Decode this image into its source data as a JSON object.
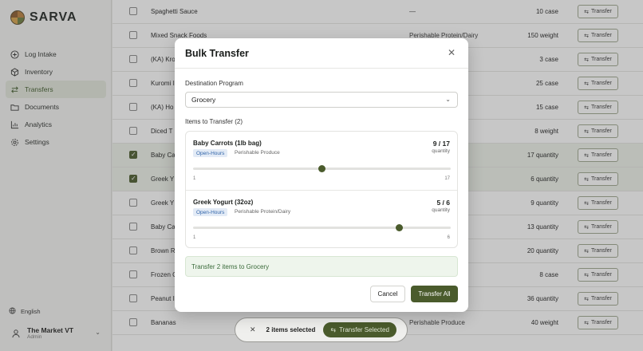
{
  "brand": {
    "name": "SARVA"
  },
  "sidebar": {
    "items": [
      {
        "label": "Log Intake",
        "icon": "plus-circle-icon"
      },
      {
        "label": "Inventory",
        "icon": "box-icon"
      },
      {
        "label": "Transfers",
        "icon": "arrows-icon",
        "active": true
      },
      {
        "label": "Documents",
        "icon": "folder-icon"
      },
      {
        "label": "Analytics",
        "icon": "chart-icon"
      },
      {
        "label": "Settings",
        "icon": "gear-icon"
      }
    ],
    "language": "English",
    "user": {
      "name": "The Market VT",
      "role": "Admin"
    }
  },
  "table": {
    "transfer_label": "Transfer",
    "rows": [
      {
        "name": "Spaghetti Sauce",
        "category": "—",
        "qty": "10 case",
        "checked": false
      },
      {
        "name": "Mixed Snack Foods",
        "category": "Perishable Protein/Dairy",
        "qty": "150 weight",
        "checked": false
      },
      {
        "name": "(KA) Kro",
        "category": "",
        "qty": "3 case",
        "checked": false
      },
      {
        "name": "Kuromi I",
        "category": "",
        "qty": "25 case",
        "checked": false
      },
      {
        "name": "(KA) Ho",
        "category": "",
        "qty": "15 case",
        "checked": false
      },
      {
        "name": "Diced T",
        "category": "",
        "qty": "8 weight",
        "checked": false
      },
      {
        "name": "Baby Ca",
        "category": "",
        "qty": "17 quantity",
        "checked": true
      },
      {
        "name": "Greek Y",
        "category": "airy",
        "qty": "6 quantity",
        "checked": true
      },
      {
        "name": "Greek Y",
        "category": "airy",
        "qty": "9 quantity",
        "checked": false
      },
      {
        "name": "Baby Ca",
        "category": "",
        "qty": "13 quantity",
        "checked": false
      },
      {
        "name": "Brown R",
        "category": "",
        "qty": "20 quantity",
        "checked": false
      },
      {
        "name": "Frozen C",
        "category": "airy",
        "qty": "8 case",
        "checked": false
      },
      {
        "name": "Peanut I",
        "category": "",
        "qty": "36 quantity",
        "checked": false
      },
      {
        "name": "Bananas",
        "category": "Perishable Produce",
        "qty": "40 weight",
        "checked": false
      }
    ]
  },
  "bottom_bar": {
    "count_label": "2 items selected",
    "button_label": "Transfer Selected"
  },
  "modal": {
    "title": "Bulk Transfer",
    "destination_label": "Destination Program",
    "destination_value": "Grocery",
    "items_label": "Items to Transfer (2)",
    "items": [
      {
        "name": "Baby Carrots (1lb bag)",
        "qty_text": "9 / 17",
        "unit": "quantity",
        "badge": "Open-Hours",
        "category": "Perishable Produce",
        "value": 9,
        "min": 1,
        "max": 17,
        "min_label": "1",
        "max_label": "17"
      },
      {
        "name": "Greek Yogurt (32oz)",
        "qty_text": "5 / 6",
        "unit": "quantity",
        "badge": "Open-Hours",
        "category": "Perishable Protein/Dairy",
        "value": 5,
        "min": 1,
        "max": 6,
        "min_label": "1",
        "max_label": "6"
      }
    ],
    "summary": "Transfer 2 items to Grocery",
    "cancel_label": "Cancel",
    "confirm_label": "Transfer All"
  }
}
